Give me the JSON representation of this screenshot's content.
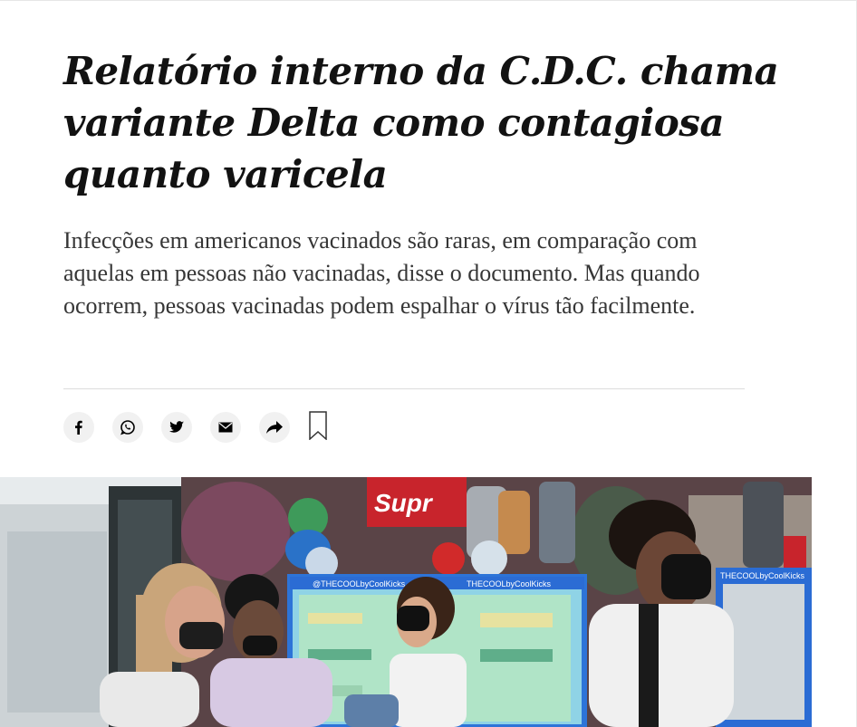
{
  "article": {
    "headline": "Relatório interno da C.D.C. chama variante Delta como contagiosa quanto varicela",
    "summary": "Infecções em americanos vacinados são raras, em comparação com aquelas em pessoas não vacinadas, disse o documento. Mas quando ocorrem, pessoas vacinadas podem espalhar o vírus tão facilmente."
  },
  "share_bar": {
    "buttons": [
      {
        "icon": "facebook-icon"
      },
      {
        "icon": "whatsapp-icon"
      },
      {
        "icon": "twitter-icon"
      },
      {
        "icon": "email-icon"
      },
      {
        "icon": "share-arrow-icon"
      },
      {
        "icon": "bookmark-icon"
      }
    ]
  },
  "photo": {
    "signs": {
      "brand_sign": "Supr",
      "shelf_sign_left": "@THECOOLbyCoolKicks",
      "shelf_sign_center": "THECOOLbyCoolKicks",
      "shelf_sign_right": "THECOOLbyCoolKicks"
    }
  },
  "colors": {
    "headline": "#121212",
    "summary": "#363636",
    "icon_bg": "#f1f1f1",
    "divider": "#dcdcdc"
  }
}
